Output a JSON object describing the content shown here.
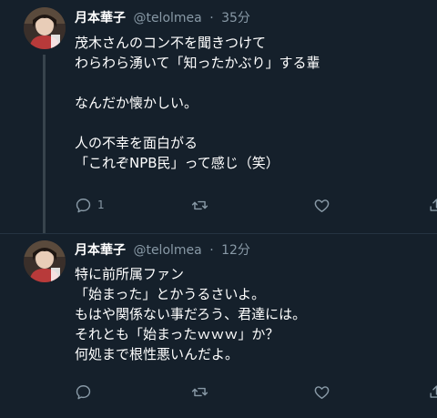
{
  "tweets": [
    {
      "name": "月本華子",
      "handle": "@telolmea",
      "separator": "·",
      "time": "35分",
      "lines": [
        "茂木さんのコン不を聞きつけて",
        "わらわら湧いて「知ったかぶり」する輩",
        "",
        "なんだか懐かしい。",
        "",
        "人の不幸を面白がる",
        "「これぞNPB民」って感じ（笑）"
      ],
      "reply_count": "1",
      "icons": [
        "reply-icon",
        "retweet-icon",
        "like-icon",
        "share-icon"
      ]
    },
    {
      "name": "月本華子",
      "handle": "@telolmea",
      "separator": "·",
      "time": "12分",
      "lines": [
        "特に前所属ファン",
        "「始まった」とかうるさいよ。",
        "もはや関係ない事だろう、君達には。",
        "それとも「始まったｗｗｗ」か？",
        "何処まで根性悪いんだよ。"
      ],
      "reply_count": "",
      "icons": [
        "reply-icon",
        "retweet-icon",
        "like-icon",
        "share-icon"
      ]
    }
  ],
  "colors": {
    "background": "#15202b",
    "secondary_text": "#8899a6",
    "thread_line": "#38444d"
  }
}
